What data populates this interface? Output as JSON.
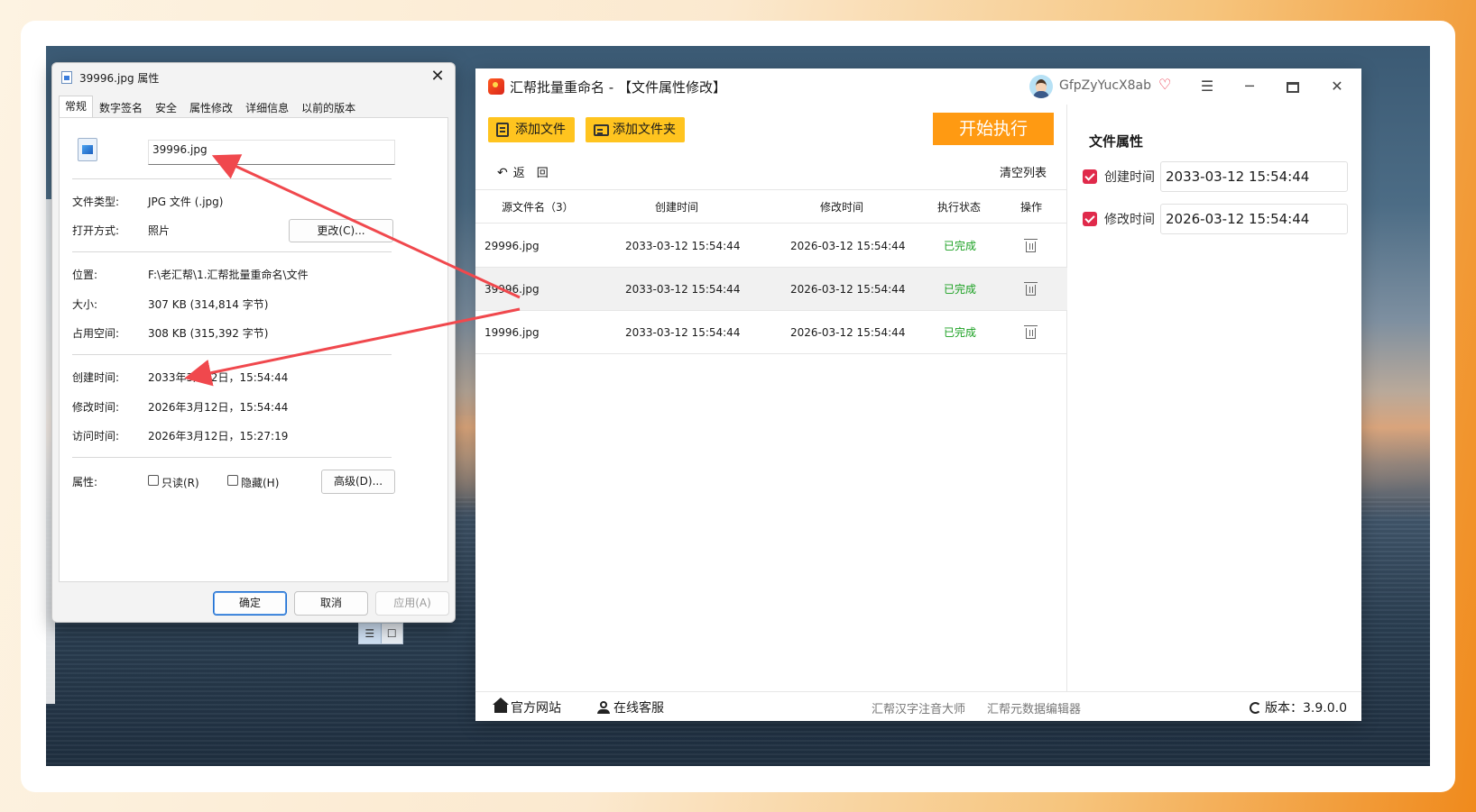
{
  "desktop": {
    "view_icons": [
      "☰",
      "☐"
    ]
  },
  "props_dialog": {
    "title": "39996.jpg 属性",
    "tabs": [
      "常规",
      "数字签名",
      "安全",
      "属性修改",
      "详细信息",
      "以前的版本"
    ],
    "filename": "39996.jpg",
    "file_type_label": "文件类型:",
    "file_type": "JPG 文件 (.jpg)",
    "open_with_label": "打开方式:",
    "open_with": "照片",
    "change_btn": "更改(C)...",
    "location_label": "位置:",
    "location": "F:\\老汇帮\\1.汇帮批量重命名\\文件",
    "size_label": "大小:",
    "size": "307 KB (314,814 字节)",
    "disk_label": "占用空间:",
    "disk": "308 KB (315,392 字节)",
    "created_label": "创建时间:",
    "created": "2033年3月12日，15:54:44",
    "modified_label": "修改时间:",
    "modified": "2026年3月12日，15:54:44",
    "accessed_label": "访问时间:",
    "accessed": "2026年3月12日，15:27:19",
    "attrs_label": "属性:",
    "readonly": "只读(R)",
    "hidden": "隐藏(H)",
    "advanced_btn": "高级(D)...",
    "ok": "确定",
    "cancel": "取消",
    "apply": "应用(A)"
  },
  "app": {
    "title": "汇帮批量重命名 - 【文件属性修改】",
    "username": "GfpZyYucX8ab",
    "add_file": "添加文件",
    "add_folder": "添加文件夹",
    "start": "开始执行",
    "back": "返　回",
    "clear_list": "清空列表",
    "columns": [
      "源文件名（3）",
      "创建时间",
      "修改时间",
      "执行状态",
      "操作"
    ],
    "rows": [
      {
        "name": "29996.jpg",
        "created": "2033-03-12 15:54:44",
        "modified": "2026-03-12 15:54:44",
        "status": "已完成"
      },
      {
        "name": "39996.jpg",
        "created": "2033-03-12 15:54:44",
        "modified": "2026-03-12 15:54:44",
        "status": "已完成"
      },
      {
        "name": "19996.jpg",
        "created": "2033-03-12 15:54:44",
        "modified": "2026-03-12 15:54:44",
        "status": "已完成"
      }
    ],
    "side": {
      "header": "文件属性",
      "created_label": "创建时间",
      "created_value": "2033-03-12 15:54:44",
      "modified_label": "修改时间",
      "modified_value": "2026-03-12 15:54:44"
    },
    "footer": {
      "website": "官方网站",
      "service": "在线客服",
      "link1": "汇帮汉字注音大师",
      "link2": "汇帮元数据编辑器",
      "version": "版本：3.9.0.0"
    }
  },
  "colors": {
    "accent_yellow": "#ffc41f",
    "start_orange": "#ff9a12",
    "status_green": "#1aa021",
    "checkbox_red": "#e02a4b",
    "arrow_red": "#f0484d"
  }
}
